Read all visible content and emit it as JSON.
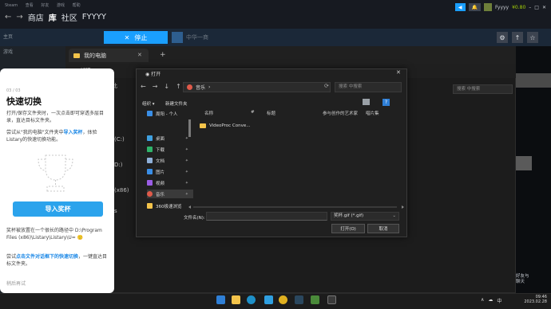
{
  "steam": {
    "menu": [
      "Steam",
      "查看",
      "好友",
      "游戏",
      "帮助"
    ],
    "nav": {
      "back": "←",
      "forward": "→",
      "store": "商店",
      "library": "库",
      "community": "社区",
      "user": "FYYYY"
    },
    "top_right": {
      "badge_label": "◀",
      "account": "Fyyyy",
      "wallet": "¥0.80",
      "min": "–",
      "max": "□",
      "close": "✕"
    },
    "home": "主页",
    "games": "游戏",
    "stop_button": "停止",
    "stop_icon_glyph": "✕",
    "game_name": "中华一商",
    "right_icons": [
      "⚙",
      "↑",
      "☆"
    ],
    "friends_chat": [
      "好友与",
      "聊天"
    ]
  },
  "listary_panel": {
    "step": "03 / 03",
    "title": "快速切换",
    "desc1": "打开/保存文件夹时，一次点击即可穿透多层目录，直达目标文件夹。",
    "desc2_before": "尝试从\"我的电脑\"文件夹中",
    "desc2_link": "导入奖杯",
    "desc2_after": "，体验Listary的快速切换功能。",
    "button": "导入奖杯",
    "desc3": "奖杯被放置在一个很长的路径中 D:\\Program Files (x86)\\Listary\\Listary\\U=",
    "desc4_before": "尝试",
    "desc4_link": "点击文件对话框下的快速切换",
    "desc4_after": "，一键直达目标文件夹。",
    "trial": "稍后再试"
  },
  "explorer": {
    "tab_title": "我的电脑",
    "tab_close": "✕",
    "tab_add": "+",
    "new": "新建",
    "address": "此",
    "search_placeholder": "搜索 中搜索",
    "left_lines": [
      "(C:)",
      "D:)",
      "(x86)",
      "s"
    ]
  },
  "dialog": {
    "title": "打开",
    "close": "✕",
    "nav": [
      "←",
      "→",
      "↓",
      "↑"
    ],
    "address": [
      "音乐",
      "›"
    ],
    "search_placeholder": "搜索 中搜索",
    "organize": "组织 ▾",
    "new_folder": "新建文件夹",
    "help": "?",
    "sidebar": [
      {
        "label": "周阳 - 个人",
        "color": "#3a8ee6"
      },
      {
        "label": "桌面",
        "color": "#3fa0e0"
      },
      {
        "label": "下载",
        "color": "#2fb36a"
      },
      {
        "label": "文档",
        "color": "#8fb0d8"
      },
      {
        "label": "图片",
        "color": "#3a8ee6"
      },
      {
        "label": "视频",
        "color": "#9b5de5"
      },
      {
        "label": "音乐",
        "color": "#e05a4a"
      },
      {
        "label": "360极速浏览",
        "color": "#f3c34a"
      }
    ],
    "columns": [
      "名称",
      "#",
      "标题",
      "参与创作的艺术家",
      "唱片集"
    ],
    "files": [
      "VideoProc Conve..."
    ],
    "filename_label": "文件名(N):",
    "filename_value": "",
    "filetype": "奖杯.gif (*.gif)",
    "open_button": "打开(O)",
    "cancel_button": "取消"
  },
  "taskbar": {
    "time": "09:46",
    "date": "2023.02.28",
    "tray": [
      "∧",
      "☁",
      "中"
    ]
  }
}
